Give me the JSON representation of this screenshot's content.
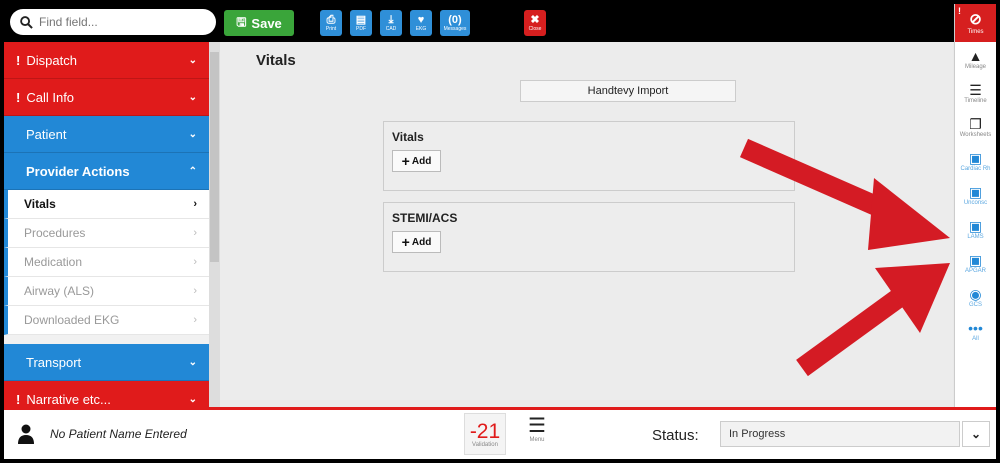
{
  "search": {
    "placeholder": "Find field..."
  },
  "toolbar": {
    "save_label": "Save",
    "buttons": [
      {
        "label": "Print",
        "icon": "print-icon"
      },
      {
        "label": "PDF",
        "icon": "pdf-icon"
      },
      {
        "label": "CAD",
        "icon": "download-icon"
      },
      {
        "label": "EKG",
        "icon": "ekg-icon"
      },
      {
        "label": "Messages",
        "count": "(0)"
      },
      {
        "label": "Close",
        "icon": "close-icon"
      }
    ]
  },
  "sidebar": {
    "sections": [
      {
        "label": "Dispatch",
        "alert": "!",
        "color": "#e01b1b"
      },
      {
        "label": "Call Info",
        "alert": "!",
        "color": "#e01b1b"
      },
      {
        "label": "Patient",
        "color": "#2288d6"
      },
      {
        "label": "Provider Actions",
        "color": "#2288d6",
        "expanded": true
      }
    ],
    "sub_items": [
      "Vitals",
      "Procedures",
      "Medication",
      "Airway (ALS)",
      "Downloaded EKG"
    ],
    "sections_after": [
      {
        "label": "Transport",
        "color": "#2288d6"
      },
      {
        "label": "Narrative etc...",
        "alert": "!",
        "color": "#e01b1b"
      }
    ]
  },
  "main": {
    "title": "Vitals",
    "import_button": "Handtevy Import",
    "boxes": [
      {
        "title": "Vitals",
        "add_label": "Add"
      },
      {
        "title": "STEMI/ACS",
        "add_label": "Add"
      }
    ]
  },
  "rightbar": {
    "times": {
      "label": "Times",
      "alert": "!"
    },
    "items": [
      {
        "label": "Mileage",
        "icon": "road-icon"
      },
      {
        "label": "Timeline",
        "icon": "sliders-icon"
      },
      {
        "label": "Worksheets",
        "icon": "copy-icon"
      },
      {
        "label": "Cardiac Rh",
        "icon": "medical-kit-icon"
      },
      {
        "label": "Unconsc",
        "icon": "medical-kit-icon"
      },
      {
        "label": "LAMS",
        "icon": "medical-kit-icon"
      },
      {
        "label": "APGAR",
        "icon": "medical-kit-icon"
      },
      {
        "label": "GCS",
        "icon": "eye-icon"
      },
      {
        "label": "All",
        "icon": "ellipsis-icon"
      }
    ]
  },
  "footer": {
    "patient_name": "No Patient Name Entered",
    "validation_count": "-21",
    "validation_label": "Validation",
    "menu_label": "Menu",
    "status_label": "Status:",
    "status_value": "In Progress"
  },
  "colors": {
    "accent_red": "#e01b1b",
    "accent_blue": "#2288d6",
    "save_green": "#3aa53a",
    "arrow_red": "#d41b24"
  }
}
